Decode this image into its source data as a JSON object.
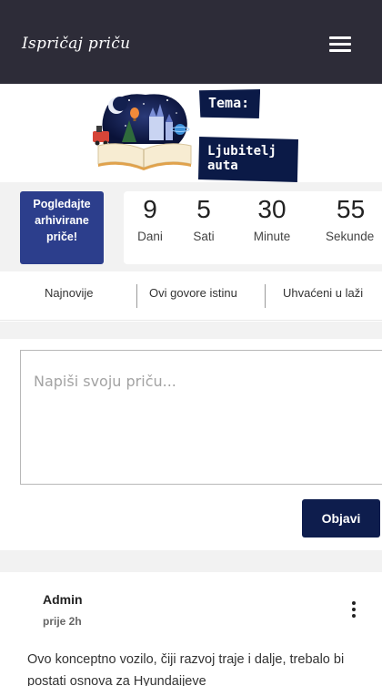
{
  "header": {
    "logo_text": "Ispričaj priču",
    "menu_icon": "hamburger-menu-icon",
    "background": "#2d2c38"
  },
  "theme": {
    "label": "Tema:",
    "topic": "Ljubitelj auta",
    "illustration_icon": "open-book-fairytale-illustration"
  },
  "countdown": {
    "archive_button": "Pogledajte arhivirane priče!",
    "units": [
      {
        "value": "9",
        "label": "Dani"
      },
      {
        "value": "5",
        "label": "Sati"
      },
      {
        "value": "30",
        "label": "Minute"
      },
      {
        "value": "55",
        "label": "Sekunde"
      }
    ]
  },
  "tabs": [
    {
      "label": "Najnovije"
    },
    {
      "label": "Ovi govore istinu"
    },
    {
      "label": "Uhvaćeni u laži"
    }
  ],
  "composer": {
    "placeholder": "Napiši svoju priču...",
    "value": "",
    "submit_label": "Objavi"
  },
  "post": {
    "author": "Admin",
    "time": "prije 2h",
    "text": "Ovo konceptno vozilo, čiji razvoj traje i dalje, trebalo bi postati osnova za Hyundaijeve",
    "menu_icon": "more-vertical-icon"
  },
  "colors": {
    "accent": "#2c3e8c",
    "dark_navy": "#0e1d4d",
    "gray_bg": "#f2f2f2"
  }
}
